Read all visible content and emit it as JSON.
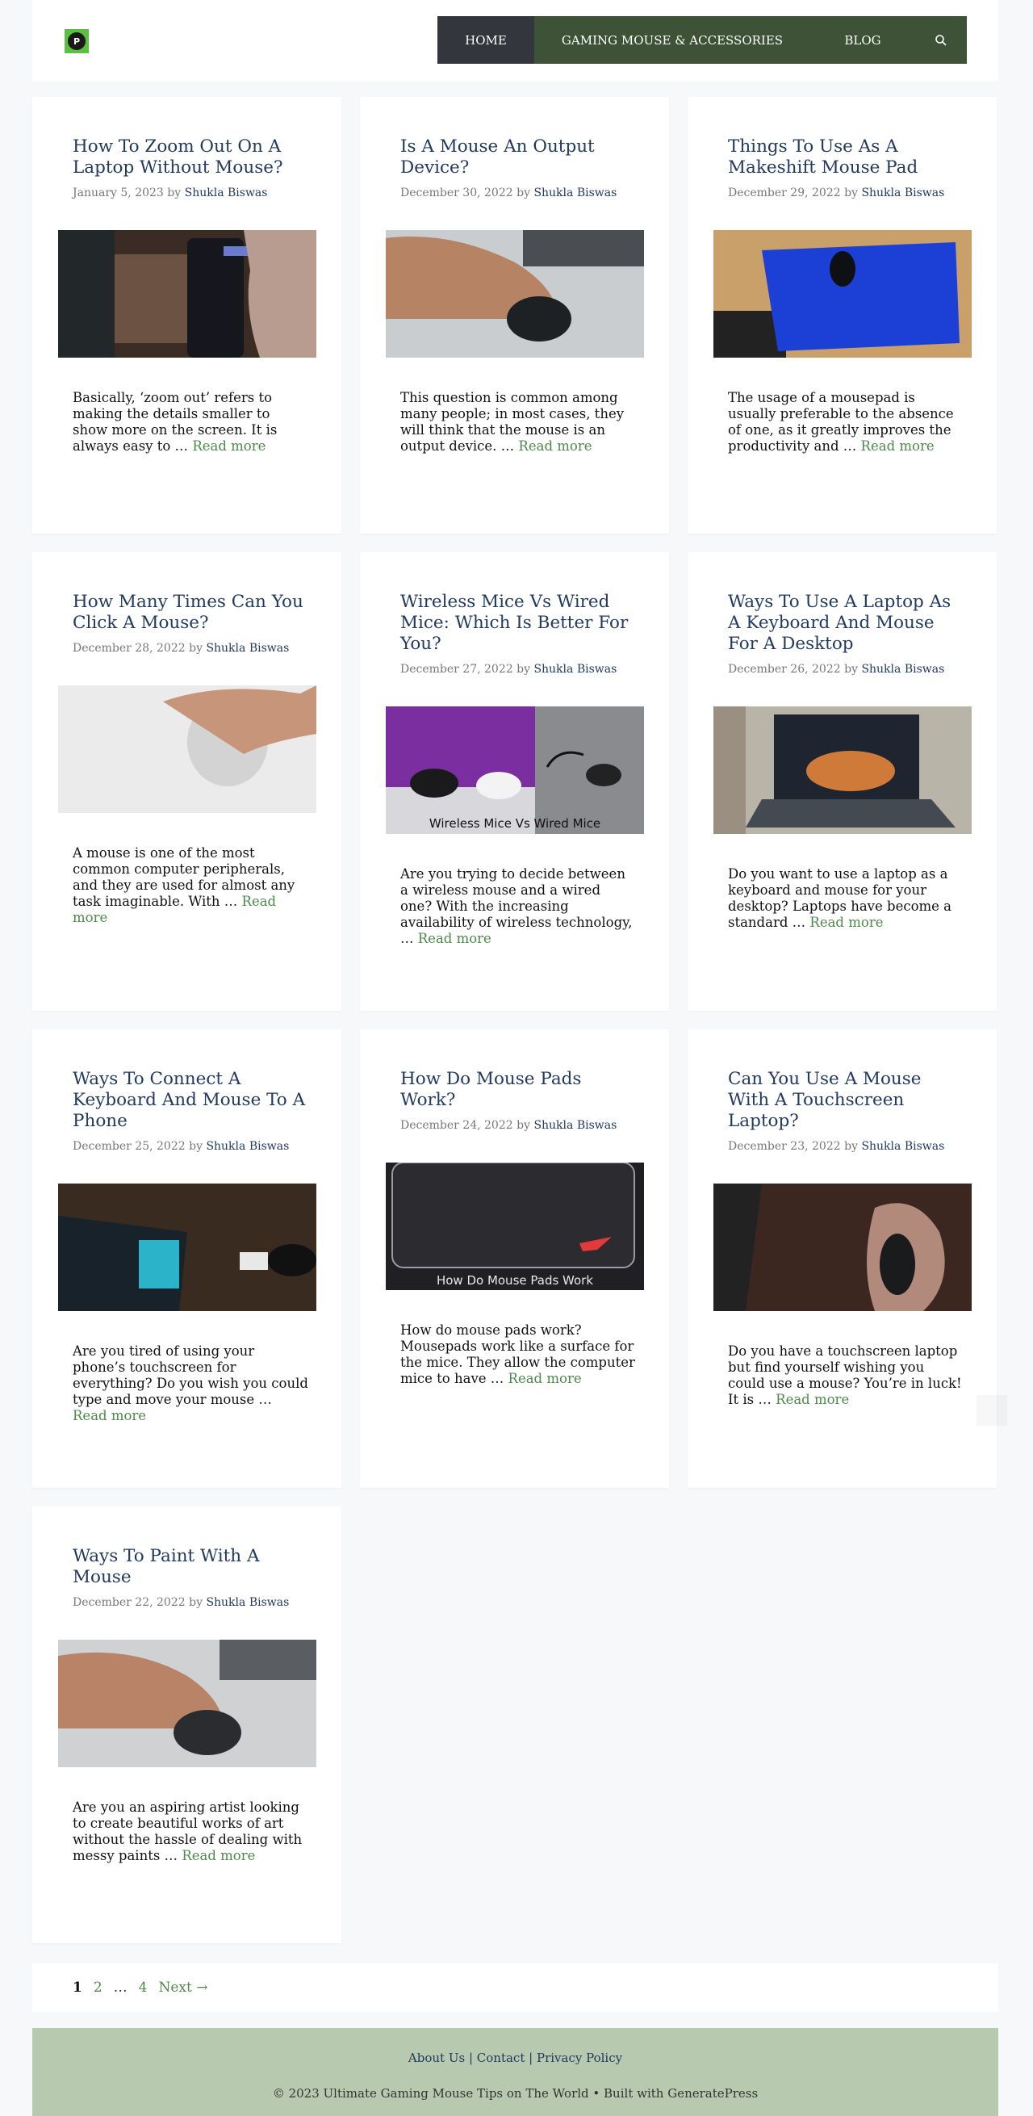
{
  "site": {
    "logo_letter": "P"
  },
  "nav": {
    "items": [
      {
        "label": "HOME"
      },
      {
        "label": "GAMING MOUSE & ACCESSORIES"
      },
      {
        "label": "BLOG"
      }
    ],
    "search_icon": "magnifier-icon"
  },
  "posts": [
    {
      "title": "How To Zoom Out On A Laptop Without Mouse?",
      "date": "January 5, 2023",
      "by": "by",
      "author": "Shukla Biswas",
      "excerpt": "Basically, ‘zoom out’ refers to making the details smaller to show more on the screen. It is always easy to … ",
      "read_more": "Read more"
    },
    {
      "title": "Is A Mouse An Output Device?",
      "date": "December 30, 2022",
      "by": "by",
      "author": "Shukla Biswas",
      "excerpt": "This question is common among many people; in most cases, they will think that the mouse is an output device. … ",
      "read_more": "Read more"
    },
    {
      "title": "Things To Use As A Makeshift Mouse Pad",
      "date": "December 29, 2022",
      "by": "by",
      "author": "Shukla Biswas",
      "excerpt": "The usage of a mousepad is usually preferable to the absence of one, as it greatly improves the productivity and … ",
      "read_more": "Read more"
    },
    {
      "title": "How Many Times Can You Click A Mouse?",
      "date": "December 28, 2022",
      "by": "by",
      "author": "Shukla Biswas",
      "excerpt": "A mouse is one of the most common computer peripherals, and they are used for almost any task imaginable. With … ",
      "read_more": "Read more"
    },
    {
      "title": "Wireless Mice Vs Wired Mice: Which Is Better For You?",
      "date": "December 27, 2022",
      "by": "by",
      "author": "Shukla Biswas",
      "excerpt": "Are you trying to decide between a wireless mouse and a wired one? With the increasing availability of wireless technology, … ",
      "read_more": "Read more",
      "image_caption": "Wireless Mice Vs Wired Mice"
    },
    {
      "title": "Ways To Use A Laptop As A Keyboard And Mouse For A Desktop",
      "date": "December 26, 2022",
      "by": "by",
      "author": "Shukla Biswas",
      "excerpt": "Do you want to use a laptop as a keyboard and mouse for your desktop? Laptops have become a standard … ",
      "read_more": "Read more"
    },
    {
      "title": "Ways To Connect A Keyboard And Mouse To A Phone",
      "date": "December 25, 2022",
      "by": "by",
      "author": "Shukla Biswas",
      "excerpt": "Are you tired of using your phone’s touchscreen for everything? Do you wish you could type and move your mouse … ",
      "read_more": "Read more"
    },
    {
      "title": "How Do Mouse Pads Work?",
      "date": "December 24, 2022",
      "by": "by",
      "author": "Shukla Biswas",
      "excerpt": "How do mouse pads work? Mousepads work like a surface for the mice. They allow the computer mice to have … ",
      "read_more": "Read more",
      "image_caption": "How Do Mouse Pads Work"
    },
    {
      "title": "Can You Use A Mouse With A Touchscreen Laptop?",
      "date": "December 23, 2022",
      "by": "by",
      "author": "Shukla Biswas",
      "excerpt": "Do you have a touchscreen laptop but find yourself wishing you could use a mouse? You’re in luck! It is … ",
      "read_more": "Read more"
    },
    {
      "title": "Ways To Paint With A Mouse",
      "date": "December 22, 2022",
      "by": "by",
      "author": "Shukla Biswas",
      "excerpt": "Are you an aspiring artist looking to create beautiful works of art without the hassle of dealing with messy paints … ",
      "read_more": "Read more"
    }
  ],
  "pagination": {
    "current": "1",
    "page2": "2",
    "dots": "…",
    "page4": "4",
    "next": "Next →"
  },
  "footer": {
    "about": "About Us",
    "sep": "|",
    "contact": "Contact",
    "privacy": "Privacy Policy",
    "copyright": "© 2023 Ultimate Gaming Mouse Tips on The World • Built with GeneratePress"
  },
  "colors": {
    "nav_bg": "#3e5237",
    "nav_active": "#33363c",
    "link_green": "#4d8a4a",
    "title_blue": "#223a5e",
    "footer_bg": "#b7cab0"
  }
}
